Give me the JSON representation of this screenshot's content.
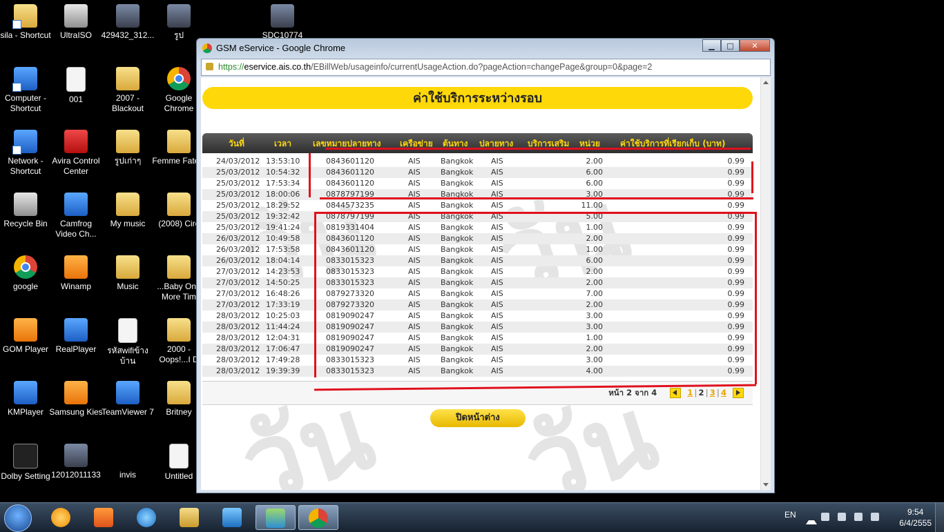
{
  "desktop": {
    "icons": [
      {
        "label": "sila - Shortcut",
        "kind": "folder"
      },
      {
        "label": "UltraISO",
        "kind": "grey"
      },
      {
        "label": "429432_312...",
        "kind": "photo"
      },
      {
        "label": "รูป",
        "kind": "photo"
      },
      {
        "label": "SDC10774",
        "kind": "photo"
      },
      {
        "label": "Computer - Shortcut",
        "kind": "blue"
      },
      {
        "label": "001",
        "kind": "doc"
      },
      {
        "label": "2007 - Blackout",
        "kind": "folder"
      },
      {
        "label": "Google Chrome",
        "kind": "chrome"
      },
      {
        "label": "Network - Shortcut",
        "kind": "blue"
      },
      {
        "label": "Avira Control Center",
        "kind": "red"
      },
      {
        "label": "รูปเก่าๆ",
        "kind": "folder"
      },
      {
        "label": "Femme Fatele",
        "kind": "folder"
      },
      {
        "label": "Recycle Bin",
        "kind": "grey"
      },
      {
        "label": "Camfrog Video Ch...",
        "kind": "blue"
      },
      {
        "label": "My music",
        "kind": "folder"
      },
      {
        "label": "(2008) Circ",
        "kind": "folder"
      },
      {
        "label": "google",
        "kind": "chrome"
      },
      {
        "label": "Winamp",
        "kind": "orange"
      },
      {
        "label": "Music",
        "kind": "folder"
      },
      {
        "label": "...Baby One More Tim",
        "kind": "folder"
      },
      {
        "label": "GOM Player",
        "kind": "orange"
      },
      {
        "label": "RealPlayer",
        "kind": "blue"
      },
      {
        "label": "รหัสwifiข้างบ้าน",
        "kind": "doc"
      },
      {
        "label": "2000 - Oops!...I D",
        "kind": "folder"
      },
      {
        "label": "KMPlayer",
        "kind": "blue"
      },
      {
        "label": "Samsung Kies",
        "kind": "orange"
      },
      {
        "label": "TeamViewer 7",
        "kind": "blue"
      },
      {
        "label": "Britney",
        "kind": "folder"
      },
      {
        "label": "Dolby Setting",
        "kind": "dark"
      },
      {
        "label": "12012011133",
        "kind": "photo"
      },
      {
        "label": "invis",
        "kind": "none"
      },
      {
        "label": "Untitled",
        "kind": "doc"
      }
    ]
  },
  "browser": {
    "title": "GSM eService - Google Chrome",
    "url_scheme": "https://",
    "url_domain": "eservice.ais.co.th",
    "url_path": "/EBillWeb/usageinfo/currentUsageAction.do?pageAction=changePage&group=0&page=2",
    "btn_minimize": "▁",
    "btn_maximize": "□",
    "btn_close": "✕"
  },
  "page": {
    "banner": "ค่าใช้บริการระหว่างรอบ",
    "watermark": "วัน",
    "columns": {
      "date": "วันที่",
      "time": "เวลา",
      "number": "เลขหมายปลายทาง",
      "network": "เครือข่าย",
      "origin": "ต้นทาง",
      "destination": "ปลายทาง",
      "extra": "บริการเสริม",
      "units": "หน่วย",
      "cost": "ค่าใช้บริการที่เรียกเก็บ (บาท)"
    },
    "rows": [
      {
        "date": "24/03/2012",
        "time": "13:53:10",
        "number": "0843601120",
        "network": "AIS",
        "origin": "Bangkok",
        "dest": "AIS",
        "units": "2.00",
        "cost": "0.99"
      },
      {
        "date": "25/03/2012",
        "time": "10:54:32",
        "number": "0843601120",
        "network": "AIS",
        "origin": "Bangkok",
        "dest": "AIS",
        "units": "6.00",
        "cost": "0.99"
      },
      {
        "date": "25/03/2012",
        "time": "17:53:34",
        "number": "0843601120",
        "network": "AIS",
        "origin": "Bangkok",
        "dest": "AIS",
        "units": "6.00",
        "cost": "0.99"
      },
      {
        "date": "25/03/2012",
        "time": "18:00:06",
        "number": "0878797199",
        "network": "AIS",
        "origin": "Bangkok",
        "dest": "AIS",
        "units": "3.00",
        "cost": "0.99"
      },
      {
        "date": "25/03/2012",
        "time": "18:29:52",
        "number": "0844573235",
        "network": "AIS",
        "origin": "Bangkok",
        "dest": "AIS",
        "units": "11.00",
        "cost": "0.99"
      },
      {
        "date": "25/03/2012",
        "time": "19:32:42",
        "number": "0878797199",
        "network": "AIS",
        "origin": "Bangkok",
        "dest": "AIS",
        "units": "5.00",
        "cost": "0.99"
      },
      {
        "date": "25/03/2012",
        "time": "19:41:24",
        "number": "0819331404",
        "network": "AIS",
        "origin": "Bangkok",
        "dest": "AIS",
        "units": "1.00",
        "cost": "0.99"
      },
      {
        "date": "26/03/2012",
        "time": "10:49:58",
        "number": "0843601120",
        "network": "AIS",
        "origin": "Bangkok",
        "dest": "AIS",
        "units": "2.00",
        "cost": "0.99"
      },
      {
        "date": "26/03/2012",
        "time": "17:53:58",
        "number": "0843601120",
        "network": "AIS",
        "origin": "Bangkok",
        "dest": "AIS",
        "units": "1.00",
        "cost": "0.99"
      },
      {
        "date": "26/03/2012",
        "time": "18:04:14",
        "number": "0833015323",
        "network": "AIS",
        "origin": "Bangkok",
        "dest": "AIS",
        "units": "6.00",
        "cost": "0.99"
      },
      {
        "date": "27/03/2012",
        "time": "14:23:53",
        "number": "0833015323",
        "network": "AIS",
        "origin": "Bangkok",
        "dest": "AIS",
        "units": "2.00",
        "cost": "0.99"
      },
      {
        "date": "27/03/2012",
        "time": "14:50:25",
        "number": "0833015323",
        "network": "AIS",
        "origin": "Bangkok",
        "dest": "AIS",
        "units": "2.00",
        "cost": "0.99"
      },
      {
        "date": "27/03/2012",
        "time": "16:48:26",
        "number": "0879273320",
        "network": "AIS",
        "origin": "Bangkok",
        "dest": "AIS",
        "units": "7.00",
        "cost": "0.99"
      },
      {
        "date": "27/03/2012",
        "time": "17:33:19",
        "number": "0879273320",
        "network": "AIS",
        "origin": "Bangkok",
        "dest": "AIS",
        "units": "2.00",
        "cost": "0.99"
      },
      {
        "date": "28/03/2012",
        "time": "10:25:03",
        "number": "0819090247",
        "network": "AIS",
        "origin": "Bangkok",
        "dest": "AIS",
        "units": "3.00",
        "cost": "0.99"
      },
      {
        "date": "28/03/2012",
        "time": "11:44:24",
        "number": "0819090247",
        "network": "AIS",
        "origin": "Bangkok",
        "dest": "AIS",
        "units": "3.00",
        "cost": "0.99"
      },
      {
        "date": "28/03/2012",
        "time": "12:04:31",
        "number": "0819090247",
        "network": "AIS",
        "origin": "Bangkok",
        "dest": "AIS",
        "units": "1.00",
        "cost": "0.99"
      },
      {
        "date": "28/03/2012",
        "time": "17:06:47",
        "number": "0819090247",
        "network": "AIS",
        "origin": "Bangkok",
        "dest": "AIS",
        "units": "2.00",
        "cost": "0.99"
      },
      {
        "date": "28/03/2012",
        "time": "17:49:28",
        "number": "0833015323",
        "network": "AIS",
        "origin": "Bangkok",
        "dest": "AIS",
        "units": "3.00",
        "cost": "0.99"
      },
      {
        "date": "28/03/2012",
        "time": "19:39:39",
        "number": "0833015323",
        "network": "AIS",
        "origin": "Bangkok",
        "dest": "AIS",
        "units": "4.00",
        "cost": "0.99"
      }
    ],
    "pager": {
      "label": "หน้า 2 จาก 4",
      "pages": [
        "1",
        "2",
        "3",
        "4"
      ],
      "current": "2"
    },
    "close_button": "ปิดหน้าต่าง",
    "annotation_color": "#e0101c"
  },
  "taskbar": {
    "lang": "EN",
    "time": "9:54",
    "date": "6/4/2555"
  }
}
